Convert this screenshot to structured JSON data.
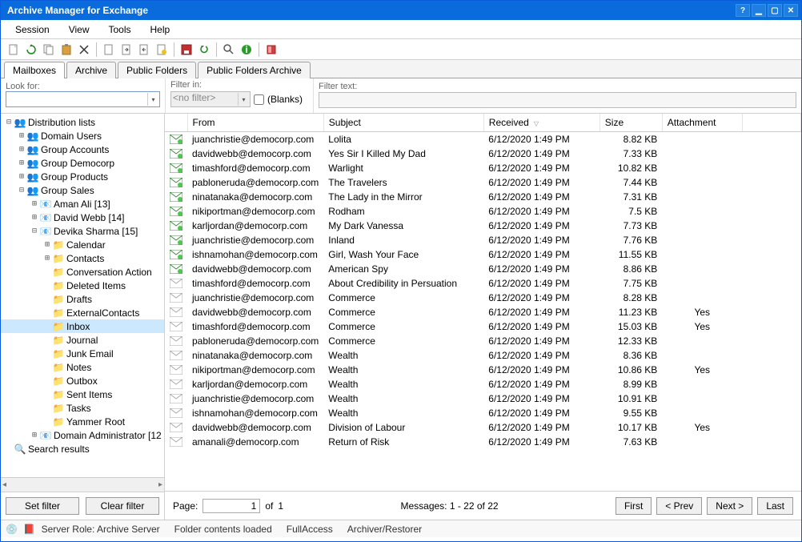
{
  "title": "Archive Manager for Exchange",
  "menu": [
    "Session",
    "View",
    "Tools",
    "Help"
  ],
  "tabs": [
    {
      "label": "Mailboxes",
      "active": true
    },
    {
      "label": "Archive",
      "active": false
    },
    {
      "label": "Public Folders",
      "active": false
    },
    {
      "label": "Public Folders Archive",
      "active": false
    }
  ],
  "filters": {
    "lookfor_label": "Look for:",
    "lookfor_value": "",
    "filterin_label": "Filter in:",
    "filterin_value": "<no filter>",
    "blanks_label": "(Blanks)",
    "filtertext_label": "Filter text:",
    "filtertext_value": ""
  },
  "tree": [
    {
      "depth": 0,
      "toggle": "-",
      "icon": "group",
      "label": "Distribution lists"
    },
    {
      "depth": 1,
      "toggle": "+",
      "icon": "group",
      "label": "Domain Users"
    },
    {
      "depth": 1,
      "toggle": "+",
      "icon": "group",
      "label": "Group Accounts"
    },
    {
      "depth": 1,
      "toggle": "+",
      "icon": "group",
      "label": "Group Democorp"
    },
    {
      "depth": 1,
      "toggle": "+",
      "icon": "group",
      "label": "Group Products"
    },
    {
      "depth": 1,
      "toggle": "-",
      "icon": "group",
      "label": "Group Sales"
    },
    {
      "depth": 2,
      "toggle": "+",
      "icon": "mailbox",
      "label": "Aman Ali [13]"
    },
    {
      "depth": 2,
      "toggle": "+",
      "icon": "mailbox",
      "label": "David Webb [14]"
    },
    {
      "depth": 2,
      "toggle": "-",
      "icon": "mailbox",
      "label": "Devika Sharma [15]"
    },
    {
      "depth": 3,
      "toggle": "+",
      "icon": "folder",
      "label": "Calendar"
    },
    {
      "depth": 3,
      "toggle": "+",
      "icon": "folder",
      "label": "Contacts"
    },
    {
      "depth": 3,
      "toggle": " ",
      "icon": "folder",
      "label": "Conversation Action"
    },
    {
      "depth": 3,
      "toggle": " ",
      "icon": "folder",
      "label": "Deleted Items"
    },
    {
      "depth": 3,
      "toggle": " ",
      "icon": "folder",
      "label": "Drafts"
    },
    {
      "depth": 3,
      "toggle": " ",
      "icon": "folder",
      "label": "ExternalContacts"
    },
    {
      "depth": 3,
      "toggle": " ",
      "icon": "folder",
      "label": "Inbox",
      "selected": true
    },
    {
      "depth": 3,
      "toggle": " ",
      "icon": "folder",
      "label": "Journal"
    },
    {
      "depth": 3,
      "toggle": " ",
      "icon": "folder",
      "label": "Junk Email"
    },
    {
      "depth": 3,
      "toggle": " ",
      "icon": "folder",
      "label": "Notes"
    },
    {
      "depth": 3,
      "toggle": " ",
      "icon": "folder",
      "label": "Outbox"
    },
    {
      "depth": 3,
      "toggle": " ",
      "icon": "folder",
      "label": "Sent Items"
    },
    {
      "depth": 3,
      "toggle": " ",
      "icon": "folder",
      "label": "Tasks"
    },
    {
      "depth": 3,
      "toggle": " ",
      "icon": "folder",
      "label": "Yammer Root"
    },
    {
      "depth": 2,
      "toggle": "+",
      "icon": "mailbox",
      "label": "Domain Administrator [12"
    },
    {
      "depth": 0,
      "toggle": " ",
      "icon": "search",
      "label": "Search results"
    }
  ],
  "left_buttons": {
    "set": "Set filter",
    "clear": "Clear filter"
  },
  "columns": {
    "from": "From",
    "subject": "Subject",
    "received": "Received",
    "size": "Size",
    "attachment": "Attachment"
  },
  "rows": [
    {
      "icon": "a",
      "from": "juanchristie@democorp.com",
      "subject": "Lolita",
      "received": "6/12/2020  1:49 PM",
      "size": "8.82 KB",
      "att": ""
    },
    {
      "icon": "a",
      "from": "davidwebb@democorp.com",
      "subject": "Yes Sir I Killed My Dad",
      "received": "6/12/2020  1:49 PM",
      "size": "7.33 KB",
      "att": ""
    },
    {
      "icon": "a",
      "from": "timashford@democorp.com",
      "subject": "Warlight",
      "received": "6/12/2020  1:49 PM",
      "size": "10.82 KB",
      "att": ""
    },
    {
      "icon": "a",
      "from": "pabloneruda@democorp.com",
      "subject": "The Travelers",
      "received": "6/12/2020  1:49 PM",
      "size": "7.44 KB",
      "att": ""
    },
    {
      "icon": "a",
      "from": "ninatanaka@democorp.com",
      "subject": "The Lady in the Mirror",
      "received": "6/12/2020  1:49 PM",
      "size": "7.31 KB",
      "att": ""
    },
    {
      "icon": "a",
      "from": "nikiportman@democorp.com",
      "subject": "Rodham",
      "received": "6/12/2020  1:49 PM",
      "size": "7.5 KB",
      "att": ""
    },
    {
      "icon": "a",
      "from": "karljordan@democorp.com",
      "subject": "My Dark Vanessa",
      "received": "6/12/2020  1:49 PM",
      "size": "7.73 KB",
      "att": ""
    },
    {
      "icon": "a",
      "from": "juanchristie@democorp.com",
      "subject": "Inland",
      "received": "6/12/2020  1:49 PM",
      "size": "7.76 KB",
      "att": ""
    },
    {
      "icon": "a",
      "from": "ishnamohan@democorp.com",
      "subject": "Girl, Wash Your Face",
      "received": "6/12/2020  1:49 PM",
      "size": "11.55 KB",
      "att": ""
    },
    {
      "icon": "a",
      "from": "davidwebb@democorp.com",
      "subject": "American Spy",
      "received": "6/12/2020  1:49 PM",
      "size": "8.86 KB",
      "att": ""
    },
    {
      "icon": "m",
      "from": "timashford@democorp.com",
      "subject": "About Credibility in Persuation",
      "received": "6/12/2020  1:49 PM",
      "size": "7.75 KB",
      "att": ""
    },
    {
      "icon": "m",
      "from": "juanchristie@democorp.com",
      "subject": "Commerce",
      "received": "6/12/2020  1:49 PM",
      "size": "8.28 KB",
      "att": ""
    },
    {
      "icon": "m",
      "from": "davidwebb@democorp.com",
      "subject": "Commerce",
      "received": "6/12/2020  1:49 PM",
      "size": "11.23 KB",
      "att": "Yes"
    },
    {
      "icon": "m",
      "from": "timashford@democorp.com",
      "subject": "Commerce",
      "received": "6/12/2020  1:49 PM",
      "size": "15.03 KB",
      "att": "Yes"
    },
    {
      "icon": "m",
      "from": "pabloneruda@democorp.com",
      "subject": "Commerce",
      "received": "6/12/2020  1:49 PM",
      "size": "12.33 KB",
      "att": ""
    },
    {
      "icon": "m",
      "from": "ninatanaka@democorp.com",
      "subject": "Wealth",
      "received": "6/12/2020  1:49 PM",
      "size": "8.36 KB",
      "att": ""
    },
    {
      "icon": "m",
      "from": "nikiportman@democorp.com",
      "subject": "Wealth",
      "received": "6/12/2020  1:49 PM",
      "size": "10.86 KB",
      "att": "Yes"
    },
    {
      "icon": "m",
      "from": "karljordan@democorp.com",
      "subject": "Wealth",
      "received": "6/12/2020  1:49 PM",
      "size": "8.99 KB",
      "att": ""
    },
    {
      "icon": "m",
      "from": "juanchristie@democorp.com",
      "subject": "Wealth",
      "received": "6/12/2020  1:49 PM",
      "size": "10.91 KB",
      "att": ""
    },
    {
      "icon": "m",
      "from": "ishnamohan@democorp.com",
      "subject": "Wealth",
      "received": "6/12/2020  1:49 PM",
      "size": "9.55 KB",
      "att": ""
    },
    {
      "icon": "m",
      "from": "davidwebb@democorp.com",
      "subject": "Division of Labour",
      "received": "6/12/2020  1:49 PM",
      "size": "10.17 KB",
      "att": "Yes"
    },
    {
      "icon": "m",
      "from": "amanali@democorp.com",
      "subject": "Return of Risk",
      "received": "6/12/2020  1:49 PM",
      "size": "7.63 KB",
      "att": ""
    }
  ],
  "pager": {
    "page_label": "Page:",
    "page_value": "1",
    "of_label": "of",
    "total_pages": "1",
    "messages_label": "Messages:  1 - 22 of 22",
    "first": "First",
    "prev": "< Prev",
    "next": "Next >",
    "last": "Last"
  },
  "status": {
    "role": "Server Role: Archive Server",
    "loaded": "Folder contents loaded",
    "access": "FullAccess",
    "archiver": "Archiver/Restorer"
  }
}
